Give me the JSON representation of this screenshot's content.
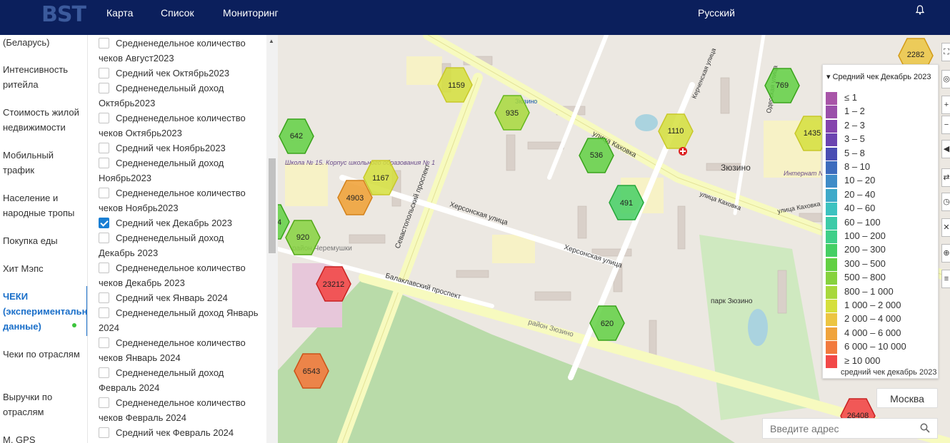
{
  "header": {
    "logo": "BST",
    "nav": [
      "Карта",
      "Список",
      "Мониторинг"
    ],
    "language": "Русский"
  },
  "sidebar": {
    "items": [
      "(Беларусь)",
      "Интенсивность ритейла",
      "Стоимость жилой недвижимости",
      "Мобильный трафик",
      "Население и народные тропы",
      "Покупка еды",
      "Хит Мэпс",
      "ЧЕКИ (экспериментальные данные)",
      "Чеки по отраслям",
      "Выручки по отраслям",
      "M. GPS"
    ],
    "active_index": 7
  },
  "layers": [
    {
      "label": "Средненедельное количество чеков Август2023",
      "checked": false
    },
    {
      "label": "Средний чек Октябрь2023",
      "checked": false
    },
    {
      "label": "Средненедельный доход Октябрь2023",
      "checked": false
    },
    {
      "label": "Средненедельное количество чеков Октябрь2023",
      "checked": false
    },
    {
      "label": "Средний чек Ноябрь2023",
      "checked": false
    },
    {
      "label": "Средненедельный доход Ноябрь2023",
      "checked": false
    },
    {
      "label": "Средненедельное количество чеков Ноябрь2023",
      "checked": false
    },
    {
      "label": "Средний чек Декабрь 2023",
      "checked": true
    },
    {
      "label": "Средненедельный доход Декабрь 2023",
      "checked": false
    },
    {
      "label": "Средненедельное количество чеков Декабрь 2023",
      "checked": false
    },
    {
      "label": "Средний чек Январь 2024",
      "checked": false
    },
    {
      "label": "Средненедельный доход Январь 2024",
      "checked": false
    },
    {
      "label": "Средненедельное количество чеков Январь 2024",
      "checked": false
    },
    {
      "label": "Средненедельный доход Февраль 2024",
      "checked": false
    },
    {
      "label": "Средненедельное количество чеков Февраль 2024",
      "checked": false
    },
    {
      "label": "Средний чек Февраль 2024",
      "checked": false
    }
  ],
  "map": {
    "labels": {
      "street1": "Севастопольский проспект",
      "street2": "Херсонская улица",
      "street3": "улица Каховка",
      "street4": "Балаклавский проспект",
      "street5": "Херсонская улица",
      "district1": "Зюзино",
      "district2": "район Черемушки",
      "district3": "район Зюзино",
      "park": "парк Зюзино",
      "school": "Школа № 15. Корпус школьного образования № 1",
      "station": "Зюзино",
      "internat": "Интернат №24",
      "street6": "Одесская улица",
      "street7": "Керченская улица",
      "street8": "улица Каховка",
      "street9": "Херсонская улица",
      "street10": "Балаклавский проспект",
      "street11": "Севастопольский проспект",
      "street12": "улица Каховка",
      "city": "Москва"
    },
    "hexes": [
      {
        "value": "1159"
      },
      {
        "value": "935"
      },
      {
        "value": "1110"
      },
      {
        "value": "769"
      },
      {
        "value": "2282"
      },
      {
        "value": "642"
      },
      {
        "value": "536"
      },
      {
        "value": "1435"
      },
      {
        "value": "1167"
      },
      {
        "value": "4903"
      },
      {
        "value": "491"
      },
      {
        "value": "920"
      },
      {
        "value": "23212"
      },
      {
        "value": "620"
      },
      {
        "value": "6543"
      },
      {
        "value": "26408"
      },
      {
        "value": "4"
      }
    ],
    "city_button": "Москва",
    "address_placeholder": "Введите адрес"
  },
  "legend": {
    "title": "Средний чек Декабрь 2023",
    "footer": "средний чек декабрь 2023",
    "ranges": [
      {
        "label": "≤ 1",
        "color": "#a855a8"
      },
      {
        "label": "1 – 2",
        "color": "#9a4faa"
      },
      {
        "label": "2 – 3",
        "color": "#8545ad"
      },
      {
        "label": "3 – 5",
        "color": "#6b44b0"
      },
      {
        "label": "5 – 8",
        "color": "#4a4db3"
      },
      {
        "label": "8 – 10",
        "color": "#3d6bbd"
      },
      {
        "label": "10 – 20",
        "color": "#3f8cc8"
      },
      {
        "label": "20 – 40",
        "color": "#3ea9c9"
      },
      {
        "label": "40 – 60",
        "color": "#3cc2c0"
      },
      {
        "label": "60 – 100",
        "color": "#3ccba8"
      },
      {
        "label": "100 – 200",
        "color": "#3fcf89"
      },
      {
        "label": "200 – 300",
        "color": "#45cf64"
      },
      {
        "label": "300 – 500",
        "color": "#62d043"
      },
      {
        "label": "500 – 800",
        "color": "#86d23e"
      },
      {
        "label": "800 – 1 000",
        "color": "#a8d83c"
      },
      {
        "label": "1 000 – 2 000",
        "color": "#d5df3c"
      },
      {
        "label": "2 000 – 4 000",
        "color": "#ecc542"
      },
      {
        "label": "4 000 – 6 000",
        "color": "#f0a33c"
      },
      {
        "label": "6 000 – 10 000",
        "color": "#f27a3e"
      },
      {
        "label": "≥ 10 000",
        "color": "#f24848"
      }
    ]
  }
}
